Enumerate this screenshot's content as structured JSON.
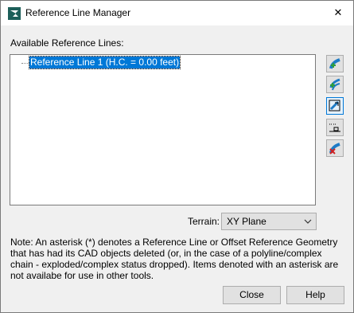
{
  "window": {
    "title": "Reference Line Manager",
    "close_label": "✕"
  },
  "list": {
    "label": "Available Reference Lines:",
    "items": [
      "Reference Line 1 (H.C. = 0.00 feet)"
    ]
  },
  "side_buttons": [
    {
      "icon": "add-reference-line-icon"
    },
    {
      "icon": "add-offset-reference-icon"
    },
    {
      "icon": "edit-reference-line-icon"
    },
    {
      "icon": "reference-line-properties-icon"
    },
    {
      "icon": "delete-reference-line-icon"
    }
  ],
  "terrain": {
    "label": "Terrain:",
    "value": "XY Plane"
  },
  "note": "Note: An asterisk (*) denotes a Reference Line or Offset Reference Geometry that has had its CAD objects deleted (or, in the case of a polyline/complex chain - exploded/complex status dropped). Items denoted with an asterisk are not availabe for use in other tools.",
  "buttons": {
    "close": "Close",
    "help": "Help"
  },
  "colors": {
    "selection": "#0078d7",
    "accent_blue": "#1e7bc6",
    "accent_green": "#2e9e3a",
    "delete_red": "#d22020"
  }
}
